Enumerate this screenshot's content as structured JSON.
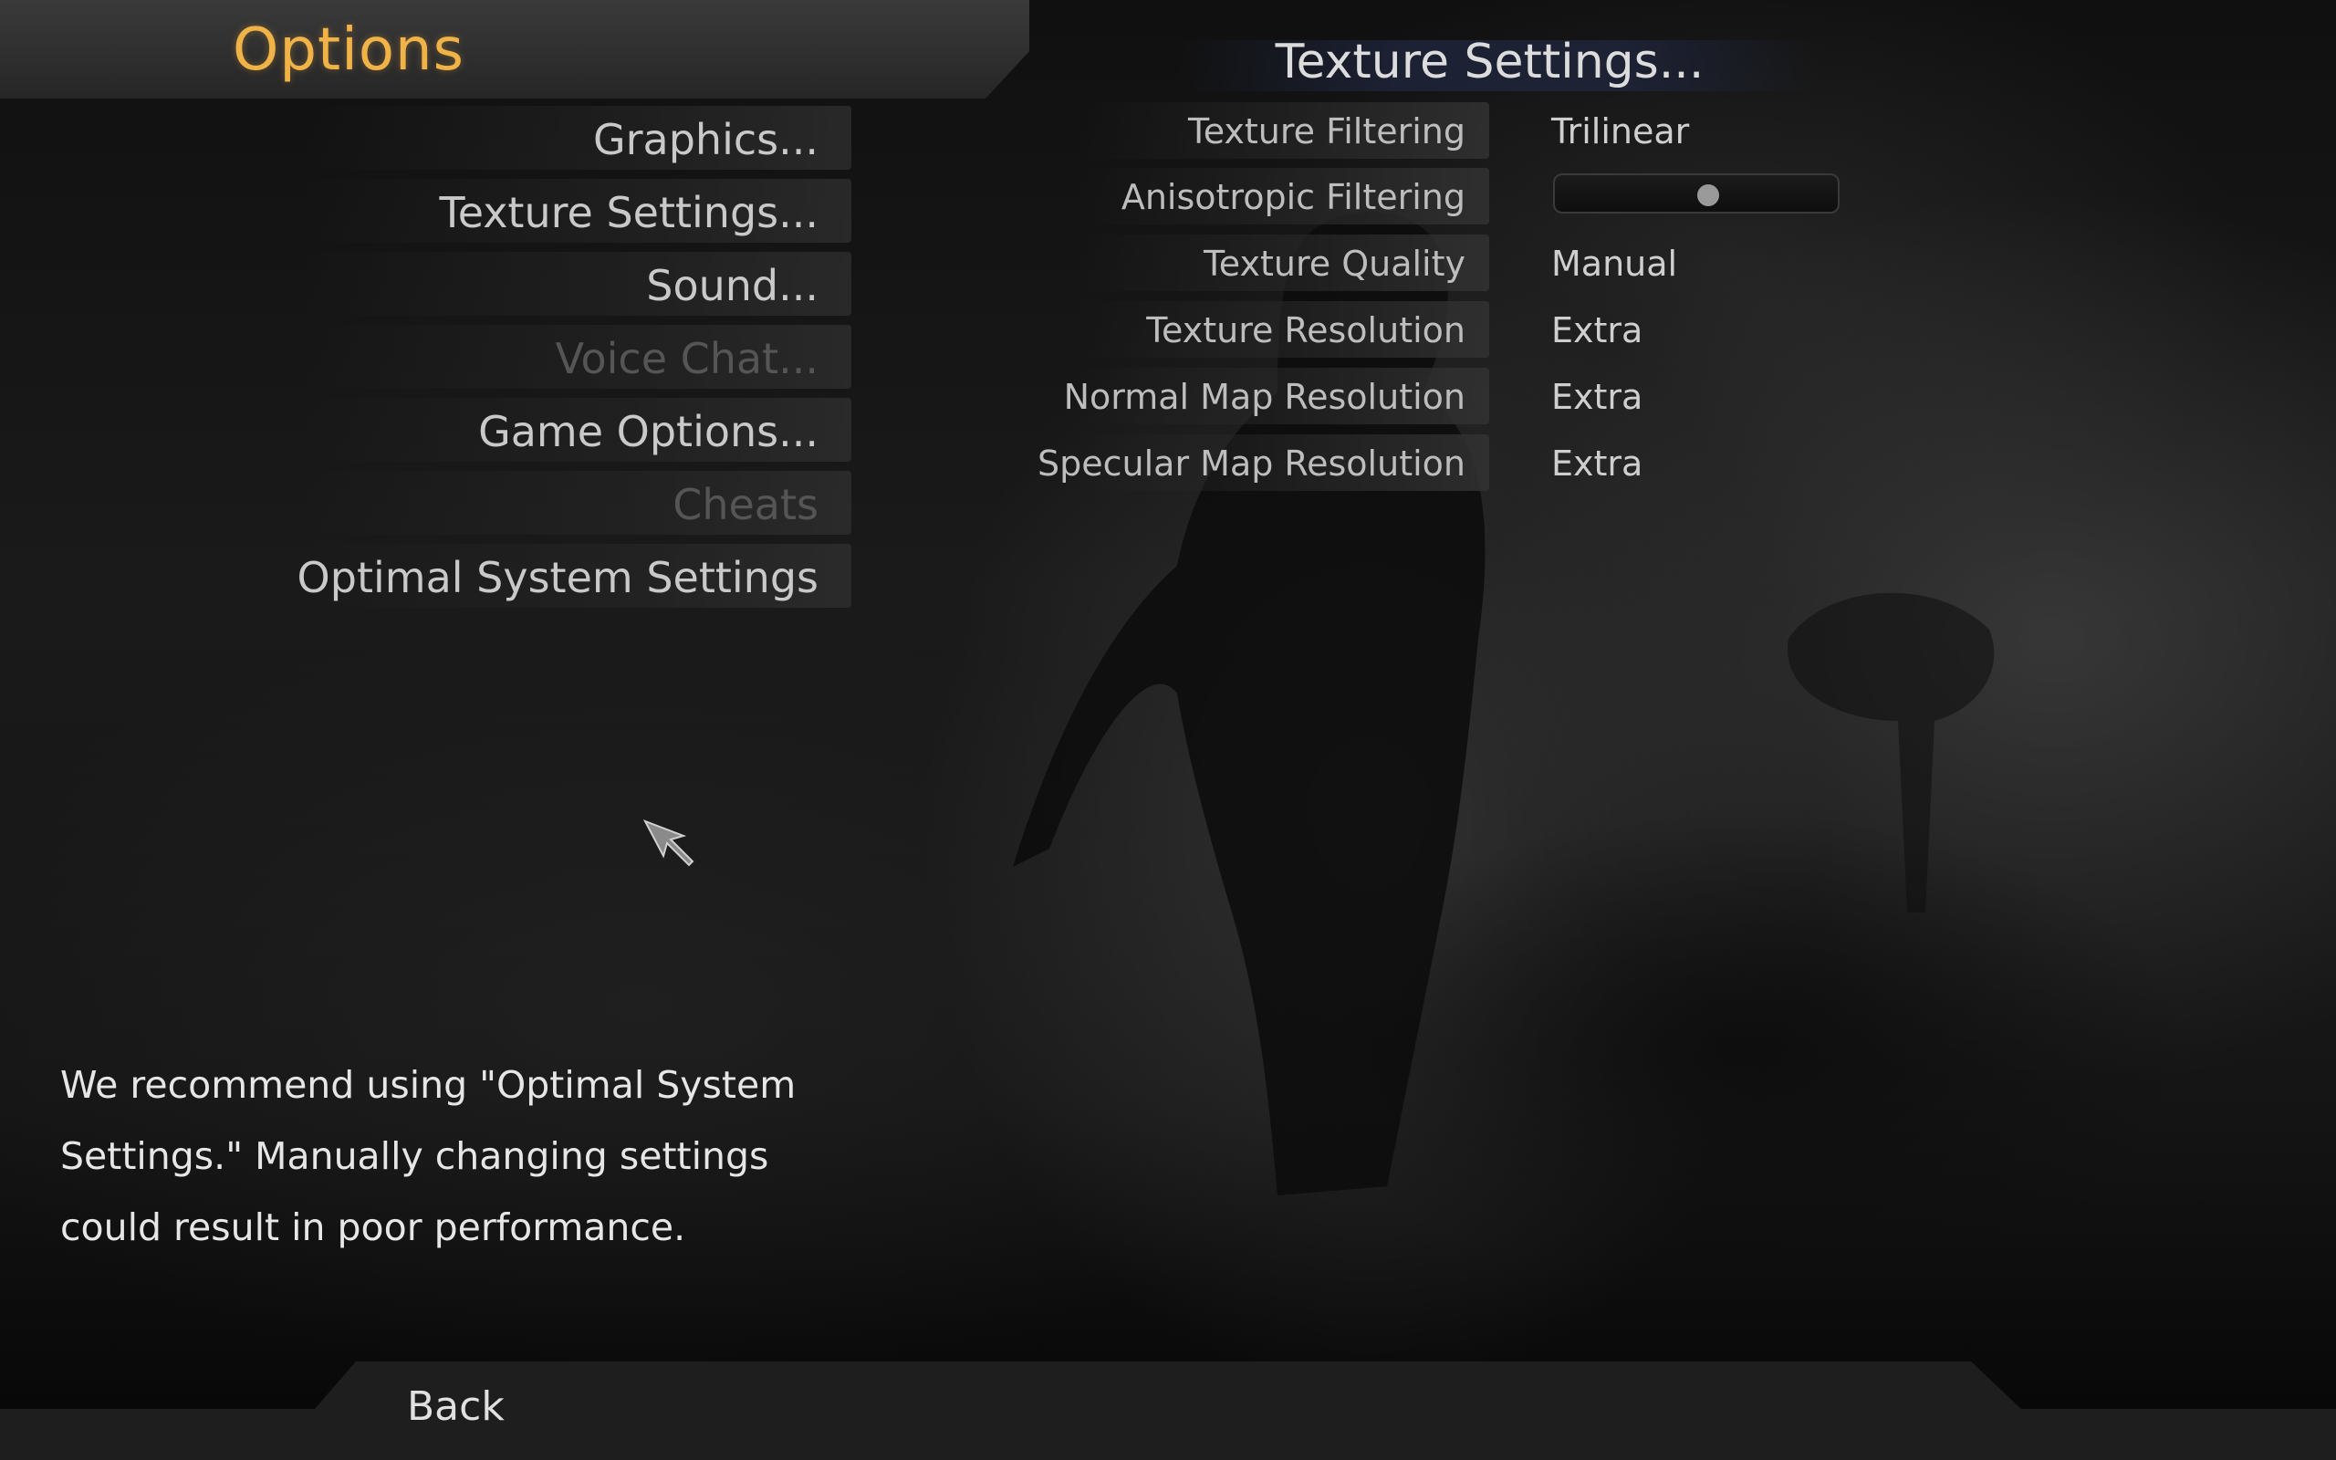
{
  "header": {
    "title": "Options"
  },
  "menu": {
    "items": [
      {
        "label": "Graphics...",
        "enabled": true
      },
      {
        "label": "Texture Settings...",
        "enabled": true
      },
      {
        "label": "Sound...",
        "enabled": true
      },
      {
        "label": "Voice Chat...",
        "enabled": false
      },
      {
        "label": "Game Options...",
        "enabled": true
      },
      {
        "label": "Cheats",
        "enabled": false
      },
      {
        "label": "Optimal System Settings",
        "enabled": true
      }
    ]
  },
  "texture_panel": {
    "title": "Texture Settings...",
    "settings": [
      {
        "label": "Texture Filtering",
        "value": "Trilinear"
      },
      {
        "label": "Anisotropic Filtering",
        "value": ""
      },
      {
        "label": "Texture Quality",
        "value": "Manual"
      },
      {
        "label": "Texture Resolution",
        "value": "Extra"
      },
      {
        "label": "Normal Map Resolution",
        "value": "Extra"
      },
      {
        "label": "Specular Map Resolution",
        "value": "Extra"
      }
    ],
    "anisotropic_level": 0.55
  },
  "hint": {
    "line1": "We recommend using \"Optimal System",
    "line2": "Settings.\"  Manually changing settings",
    "line3": "could result in poor performance."
  },
  "footer": {
    "back_label": "Back"
  },
  "colors": {
    "accent": "#f0b347",
    "text": "#c9c9c9",
    "disabled": "#555555"
  },
  "icons": {
    "cursor": "arrow-cursor-icon"
  }
}
